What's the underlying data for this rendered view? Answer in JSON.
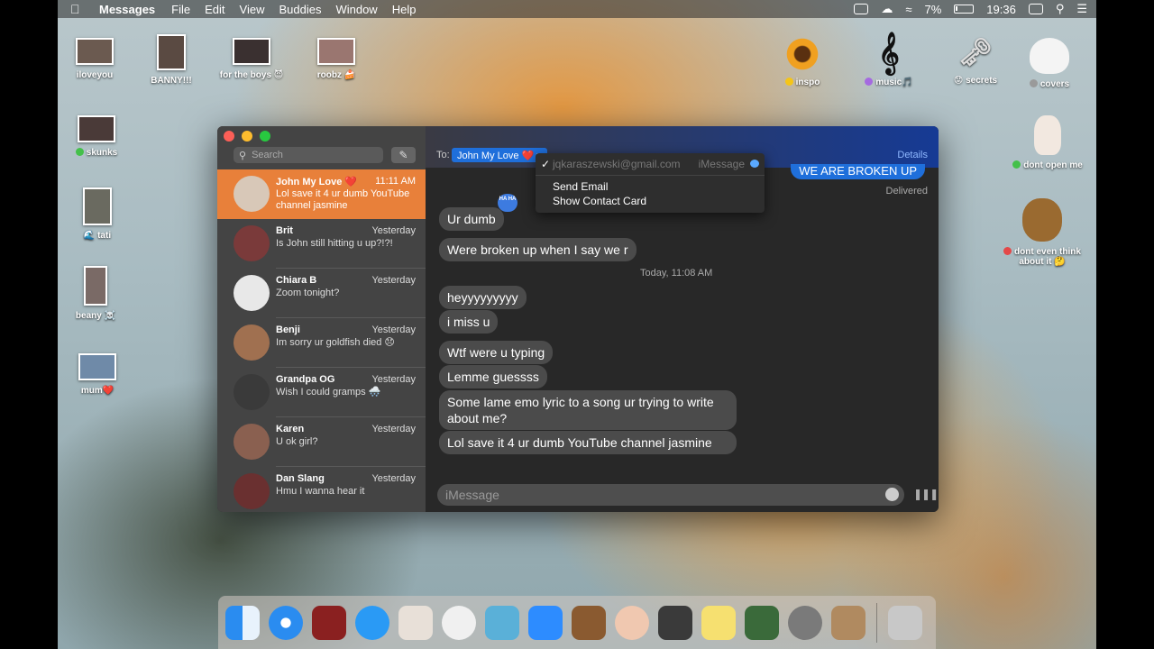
{
  "menubar": {
    "app": "Messages",
    "menus": [
      "File",
      "Edit",
      "View",
      "Buddies",
      "Window",
      "Help"
    ],
    "battery": "7%",
    "clock": "19:36"
  },
  "desktop_icons": [
    {
      "label": "iloveyou",
      "tag_color": ""
    },
    {
      "label": "BANNY!!!",
      "tag_color": ""
    },
    {
      "label": "for the boys 😈",
      "tag_color": ""
    },
    {
      "label": "roobz 🍰",
      "tag_color": ""
    },
    {
      "label": "skunks",
      "tag_color": "#44c04a"
    },
    {
      "label": "🌊 tati",
      "tag_color": ""
    },
    {
      "label": "beany ☠️",
      "tag_color": ""
    },
    {
      "label": "mum❤️",
      "tag_color": ""
    },
    {
      "label": "inspo",
      "tag_color": "#f5c518"
    },
    {
      "label": "music🎵",
      "tag_color": "#a56ae0"
    },
    {
      "label": "😟 secrets",
      "tag_color": ""
    },
    {
      "label": "covers",
      "tag_color": "#9a9a9a"
    },
    {
      "label": "dont open me",
      "tag_color": "#44c04a"
    },
    {
      "label": "dont even think about it 🤔",
      "tag_color": "#e44848"
    }
  ],
  "sidebar": {
    "search_placeholder": "Search",
    "conversations": [
      {
        "name": "John My Love ❤️",
        "time": "11:11 AM",
        "preview": "Lol save it 4 ur dumb YouTube channel jasmine",
        "active": true
      },
      {
        "name": "Brit",
        "time": "Yesterday",
        "preview": "Is John still hitting u up?!?!"
      },
      {
        "name": "Chiara B",
        "time": "Yesterday",
        "preview": "Zoom tonight?"
      },
      {
        "name": "Benji",
        "time": "Yesterday",
        "preview": "Im sorry ur goldfish died 😞"
      },
      {
        "name": "Grandpa OG",
        "time": "Yesterday",
        "preview": "Wish I could gramps 🌨️"
      },
      {
        "name": "Karen",
        "time": "Yesterday",
        "preview": "U ok girl?"
      },
      {
        "name": "Dan Slang",
        "time": "Yesterday",
        "preview": "Hmu I wanna hear it"
      }
    ]
  },
  "chat": {
    "to_label": "To:",
    "recipient": "John My Love ❤️",
    "details": "Details",
    "sent_message": "WE ARE BROKEN UP",
    "delivered": "Delivered",
    "tapback": "HA HA",
    "timestamp": "Today, 11:08 AM",
    "messages": [
      "Ur dumb",
      "Were broken up when I say we r",
      "heyyyyyyyyy",
      "i miss u",
      "Wtf were u typing",
      "Lemme guessss",
      "Some lame emo lyric to a song ur trying to write about me?",
      "Lol save it 4 ur dumb YouTube channel jasmine"
    ],
    "input_placeholder": "iMessage"
  },
  "popup_menu": {
    "address": "jqkaraszewski@gmail.com",
    "service": "iMessage",
    "items": [
      "Send Email",
      "Show Contact Card"
    ]
  },
  "dock": [
    "Finder",
    "Safari",
    "Photo Booth",
    "Messages",
    "Scrobbles",
    "iTunes",
    "Seal",
    "Zoom",
    "GarageBand",
    "Face",
    "Voice Memos",
    "Stickies",
    "Preview",
    "System Preferences",
    "Contacts",
    "Trash"
  ]
}
